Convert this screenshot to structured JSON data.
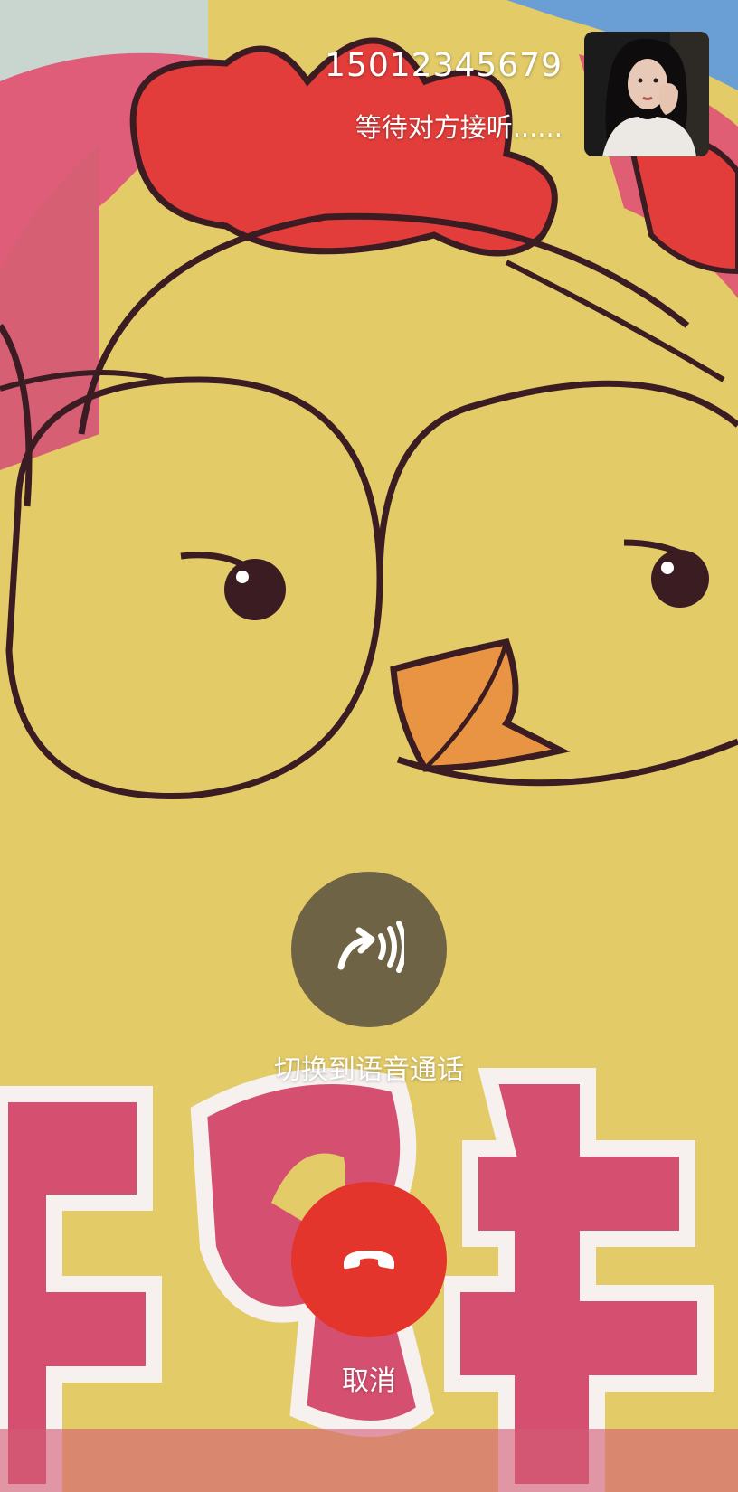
{
  "call": {
    "number": "15012345679",
    "status": "等待对方接听......"
  },
  "actions": {
    "switch_to_voice": {
      "label": "切换到语音通话",
      "icon": "voice-call-switch-icon",
      "color": "#6e6344"
    },
    "cancel": {
      "label": "取消",
      "icon": "hang-up-icon",
      "color": "#e3352b"
    }
  },
  "preview": {
    "icon": "remote-video-thumbnail"
  }
}
